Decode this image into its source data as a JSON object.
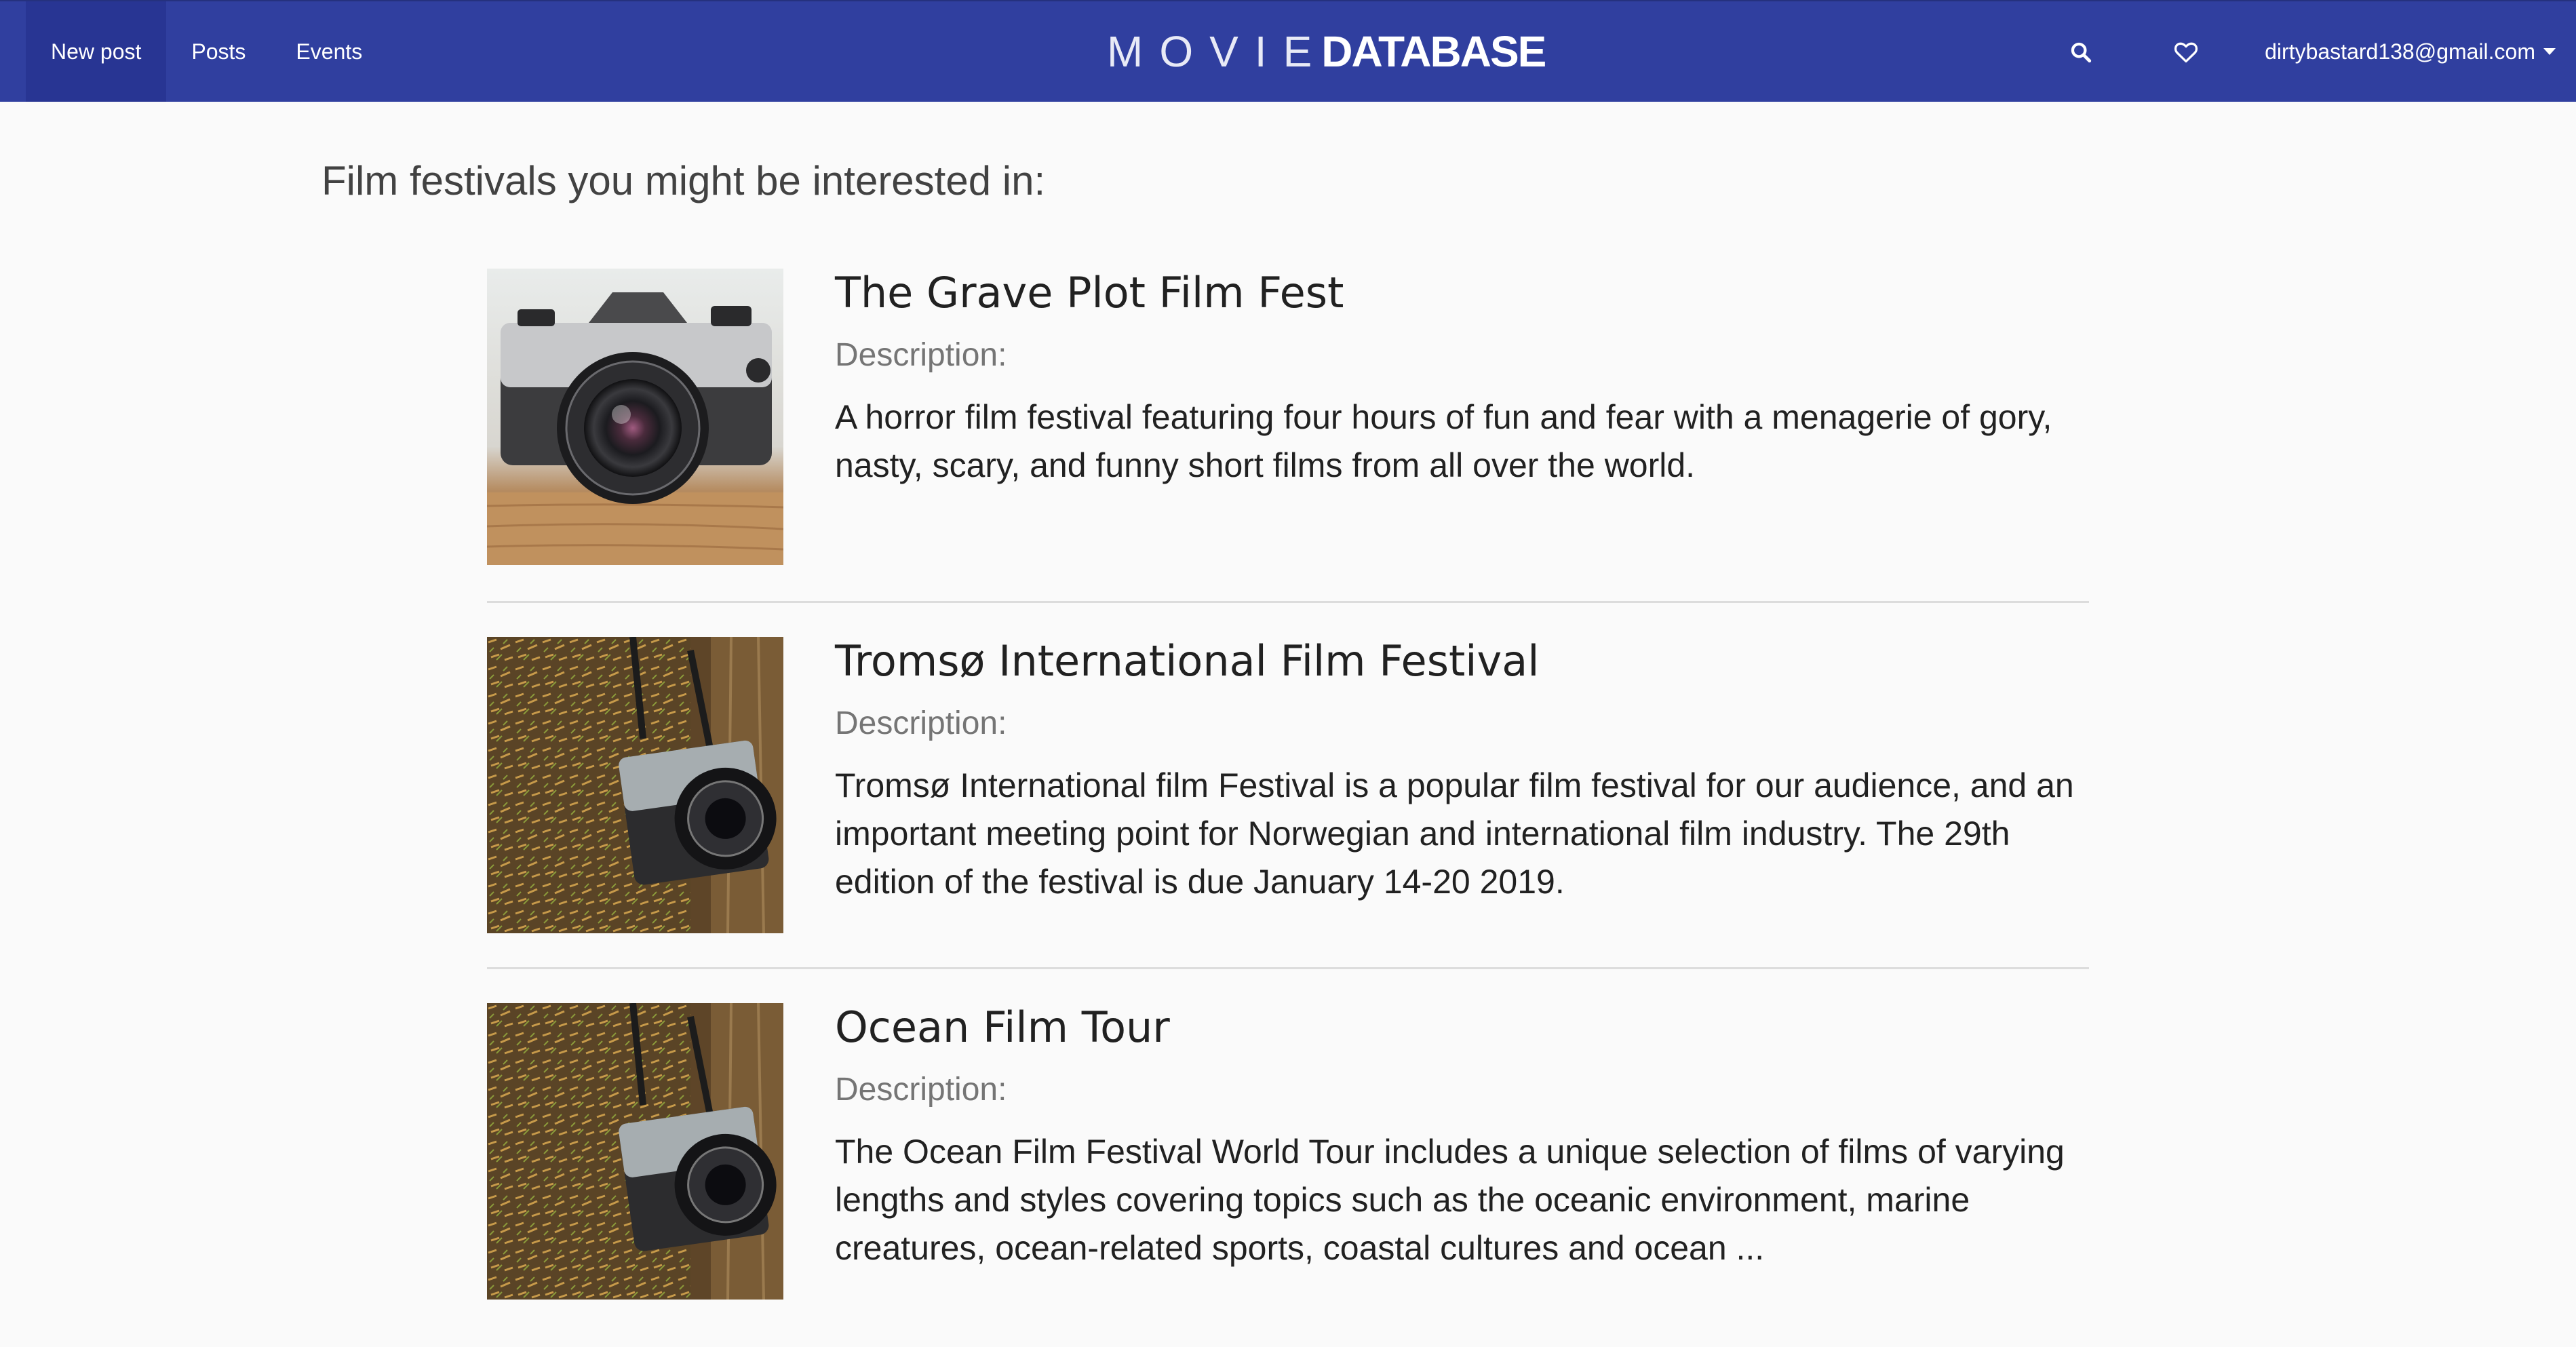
{
  "nav": {
    "items": [
      {
        "label": "New post",
        "active": true
      },
      {
        "label": "Posts",
        "active": false
      },
      {
        "label": "Events",
        "active": false
      }
    ],
    "brand_light": "MOVIE",
    "brand_bold": "DATABASE",
    "search_icon": "search-icon",
    "favorites_icon": "heart-icon",
    "user_email": "dirtybastard138@gmail.com"
  },
  "page": {
    "heading": "Film festivals you might be interested in:"
  },
  "events": [
    {
      "title": "The Grave Plot Film Fest",
      "description_label": "Description:",
      "description": "A horror film festival featuring four hours of fun and fear with a menagerie of gory, nasty, scary, and funny short films from all over the world.",
      "image": "camera-closeup"
    },
    {
      "title": "Tromsø International Film Festival",
      "description_label": "Description:",
      "description": "Tromsø International film Festival is a popular film festival for our audience, and an important meeting point for Norwegian and international film industry. The 29th edition of the festival is due January 14-20 2019.",
      "image": "camera-hanging"
    },
    {
      "title": "Ocean Film Tour",
      "description_label": "Description:",
      "description": "The Ocean Film Festival World Tour includes a unique selection of films of varying lengths and styles covering topics such as the oceanic environment, marine creatures, ocean-related sports, coastal cultures and ocean ...",
      "image": "camera-hanging"
    }
  ],
  "colors": {
    "navbar": "#303f9f",
    "navbar_active": "#283593",
    "background": "#fafafa"
  }
}
